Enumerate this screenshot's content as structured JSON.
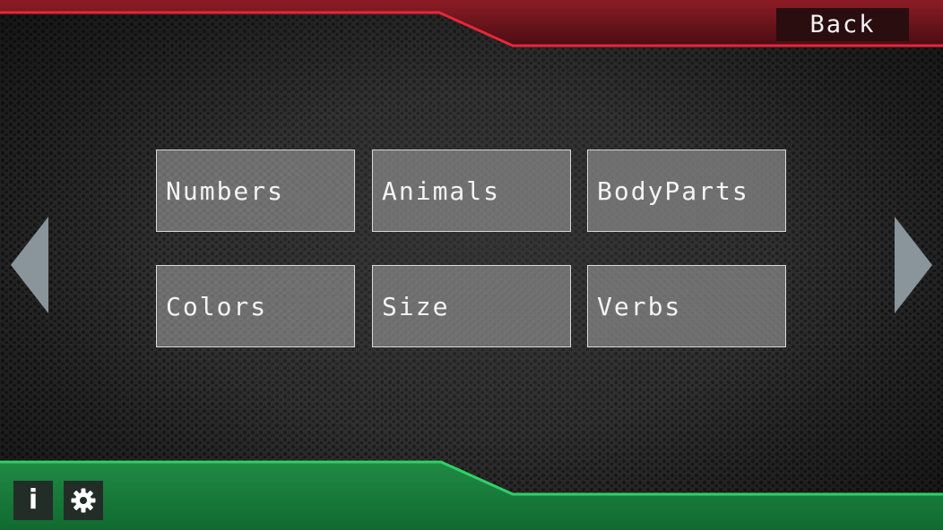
{
  "header": {
    "back_label": "Back"
  },
  "categories": [
    {
      "label": "Numbers"
    },
    {
      "label": "Animals"
    },
    {
      "label": "BodyParts"
    },
    {
      "label": "Colors"
    },
    {
      "label": "Size"
    },
    {
      "label": "Verbs"
    }
  ],
  "icons": {
    "prev": "chevron-left-icon",
    "next": "chevron-right-icon",
    "info": "info-icon",
    "settings": "gear-icon"
  },
  "footer": {
    "info_glyph": "i"
  },
  "colors": {
    "top_accent": "#e8263a",
    "top_bar": "#7a1a21",
    "bottom_accent": "#2fd165",
    "bottom_bar": "#1b7a3c",
    "arrow": "#8a949b"
  }
}
